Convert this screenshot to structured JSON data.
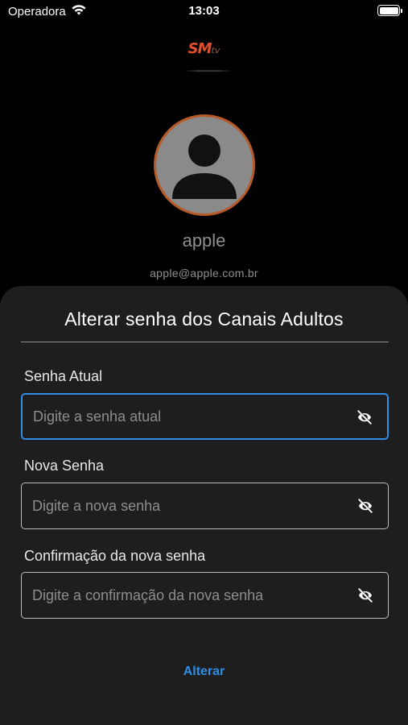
{
  "status_bar": {
    "carrier": "Operadora",
    "time": "13:03"
  },
  "logo": {
    "brand_main": "SM",
    "brand_suffix": "tv",
    "brand_color": "#e2502a"
  },
  "profile": {
    "avatar_icon": "person-icon",
    "avatar_border_color": "#b55a28",
    "username": "apple",
    "email": "apple@apple.com.br"
  },
  "form": {
    "title": "Alterar senha dos Canais Adultos",
    "fields": [
      {
        "label": "Senha Atual",
        "placeholder": "Digite a senha atual",
        "value": "",
        "focused": true,
        "icon": "eye-slash-icon"
      },
      {
        "label": "Nova Senha",
        "placeholder": "Digite a nova senha",
        "value": "",
        "focused": false,
        "icon": "eye-slash-icon"
      },
      {
        "label": "Confirmação da nova senha",
        "placeholder": "Digite a confirmação da nova senha",
        "value": "",
        "focused": false,
        "icon": "eye-slash-icon"
      }
    ],
    "submit_label": "Alterar",
    "accent_color": "#2f8de4"
  }
}
